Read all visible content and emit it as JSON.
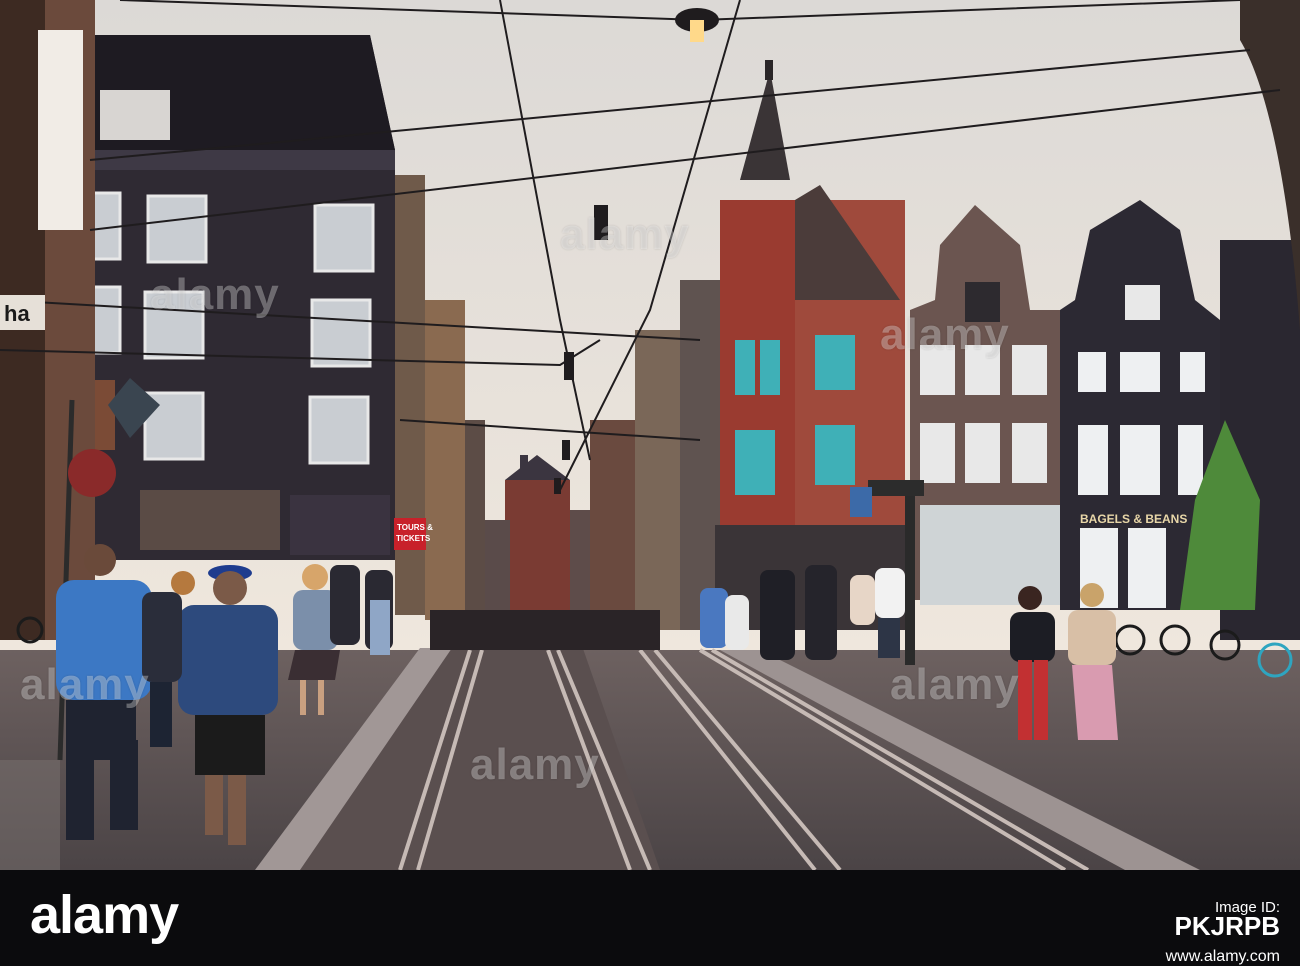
{
  "photo": {
    "signs": {
      "left_fragment": "ha",
      "tours_top": "TOURS &",
      "tours_bottom": "TICKETS",
      "bagels": "BAGELS & BEANS"
    },
    "colors": {
      "sky": "#e9e3dc",
      "street": "#5d5554",
      "dark_building": "#2f2a33",
      "red_building": "#9a3b30"
    }
  },
  "watermarks": [
    "alamy",
    "alamy",
    "alamy",
    "alamy",
    "alamy",
    "alamy"
  ],
  "footer": {
    "brand": "alamy",
    "id_label": "Image ID:",
    "id_value": "PKJRPB",
    "site": "www.alamy.com"
  }
}
